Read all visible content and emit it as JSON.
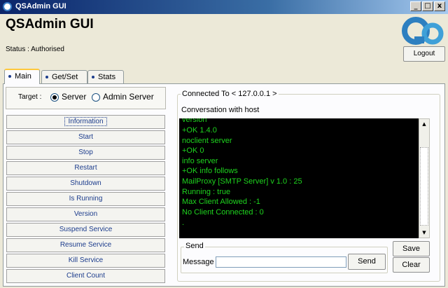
{
  "window": {
    "title": "QSAdmin GUI",
    "buttons": [
      "_",
      "□",
      "x"
    ]
  },
  "header": {
    "title": "QSAdmin GUI",
    "status": "Status : Authorised",
    "logout_label": "Logout"
  },
  "tabs": [
    {
      "label": "Main",
      "active": true
    },
    {
      "label": "Get/Set",
      "active": false
    },
    {
      "label": "Stats",
      "active": false
    }
  ],
  "target": {
    "label": "Target :",
    "options": [
      {
        "label": "Server",
        "checked": true
      },
      {
        "label": "Admin Server",
        "checked": false
      }
    ]
  },
  "commands": [
    "Information",
    "Start",
    "Stop",
    "Restart",
    "Shutdown",
    "Is Running",
    "Version",
    "Suspend Service",
    "Resume Service",
    "Kill Service",
    "Client Count"
  ],
  "connection": {
    "label": "Connected To < 127.0.0.1 >",
    "conversation_label": "Conversation with host"
  },
  "console_lines": [
    "version",
    "+OK 1.4.0",
    "noclient server",
    "+OK 0",
    "info server",
    "+OK info follows",
    "MailProxy [SMTP Server] v 1.0 : 25",
    "Running : true",
    "Max Client Allowed  : -1",
    "No Client Connected : 0",
    "."
  ],
  "send": {
    "group_label": "Send",
    "message_label": "Message",
    "message_value": "",
    "send_label": "Send"
  },
  "actions": {
    "save_label": "Save",
    "clear_label": "Clear"
  },
  "colors": {
    "console_bg": "#000000",
    "console_text": "#1ed41e",
    "command_text": "#1c3c8c",
    "titlebar": "#0a246a"
  }
}
